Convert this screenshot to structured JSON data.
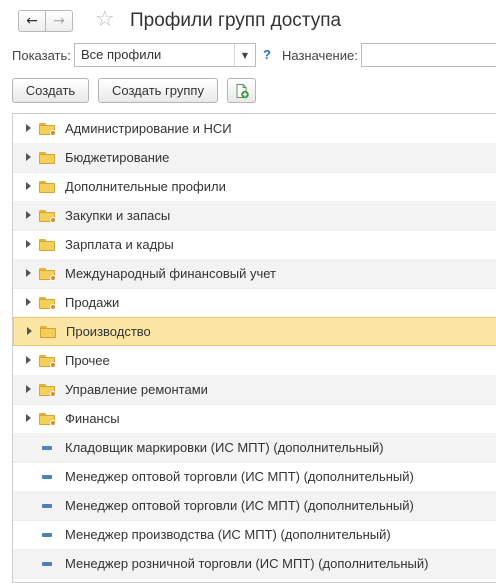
{
  "header": {
    "title": "Профили групп доступа",
    "back_icon": "←",
    "forward_icon": "→",
    "star_icon": "☆"
  },
  "filter": {
    "show_label": "Показать:",
    "show_value": "Все профили",
    "help_mark": "?",
    "purpose_label": "Назначение:",
    "purpose_value": ""
  },
  "toolbar": {
    "create_label": "Создать",
    "create_group_label": "Создать группу",
    "copy_icon": "copy-plus-icon"
  },
  "tree": {
    "selected_index": 7,
    "groups": [
      {
        "label": "Администрирование и НСИ",
        "badge": true
      },
      {
        "label": "Бюджетирование",
        "badge": false
      },
      {
        "label": "Дополнительные профили",
        "badge": false
      },
      {
        "label": "Закупки и запасы",
        "badge": true
      },
      {
        "label": "Зарплата и кадры",
        "badge": false
      },
      {
        "label": "Международный финансовый учет",
        "badge": true
      },
      {
        "label": "Продажи",
        "badge": true
      },
      {
        "label": "Производство",
        "badge": false
      },
      {
        "label": "Прочее",
        "badge": true
      },
      {
        "label": "Управление ремонтами",
        "badge": true
      },
      {
        "label": "Финансы",
        "badge": true
      }
    ],
    "items": [
      {
        "label": "Кладовщик маркировки (ИС МПТ) (дополнительный)"
      },
      {
        "label": "Менеджер оптовой торговли (ИС МПТ) (дополнительный)"
      },
      {
        "label": "Менеджер оптовой торговли (ИС МПТ) (дополнительный)"
      },
      {
        "label": "Менеджер производства (ИС МПТ) (дополнительный)"
      },
      {
        "label": "Менеджер розничной торговли (ИС МПТ) (дополнительный)"
      }
    ]
  },
  "colors": {
    "selection": "#fbe6a6",
    "accent": "#2a6fc9",
    "folder": "#f4cf59"
  }
}
